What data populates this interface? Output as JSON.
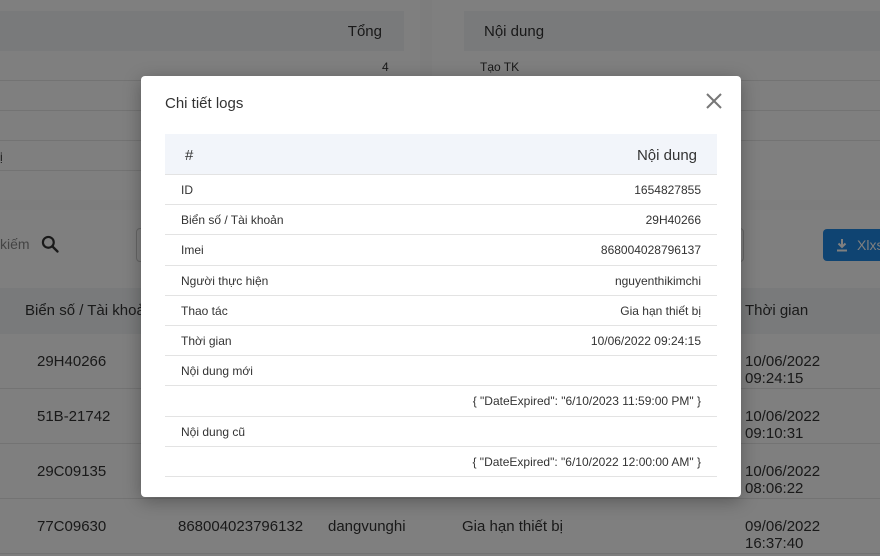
{
  "background": {
    "summary_table": {
      "header_total": "Tổng",
      "row1_total": "4",
      "row3_cut_text": "ị"
    },
    "log_table": {
      "header_content": "Nội dung",
      "row1_content": "Tạo TK"
    },
    "search": {
      "label": "kiếm"
    },
    "export_button": {
      "label": "Xlxs"
    },
    "main_table": {
      "headers": {
        "plate": "Biển số / Tài khoản",
        "time": "Thời gian"
      },
      "rows": [
        {
          "plate": "29H40266",
          "imei": "",
          "user": "",
          "action": "",
          "time": "10/06/2022 09:24:15"
        },
        {
          "plate": "51B-21742",
          "imei": "",
          "user": "",
          "action": "",
          "time": "10/06/2022 09:10:31"
        },
        {
          "plate": "29C09135",
          "imei": "",
          "user": "",
          "action": "",
          "time": "10/06/2022 08:06:22"
        },
        {
          "plate": "77C09630",
          "imei": "868004023796132",
          "user": "dangvunghi",
          "action": "Gia hạn thiết bị",
          "time": "09/06/2022 16:37:40"
        }
      ]
    }
  },
  "modal": {
    "title": "Chi tiết logs",
    "table": {
      "header_index": "#",
      "header_content": "Nội dung",
      "rows": [
        {
          "key": "ID",
          "value": "1654827855"
        },
        {
          "key": "Biển số / Tài khoản",
          "value": "29H40266"
        },
        {
          "key": "Imei",
          "value": "868004028796137"
        },
        {
          "key": "Người thực hiện",
          "value": "nguyenthikimchi"
        },
        {
          "key": "Thao tác",
          "value": "Gia hạn thiết bị"
        },
        {
          "key": "Thời gian",
          "value": "10/06/2022 09:24:15"
        },
        {
          "key": "Nội dung mới",
          "value": ""
        },
        {
          "key": "",
          "value": "{ \"DateExpired\": \"6/10/2023 11:59:00 PM\" }"
        },
        {
          "key": "Nội dung cũ",
          "value": ""
        },
        {
          "key": "",
          "value": "{ \"DateExpired\": \"6/10/2022 12:00:00 AM\" }"
        }
      ]
    }
  }
}
